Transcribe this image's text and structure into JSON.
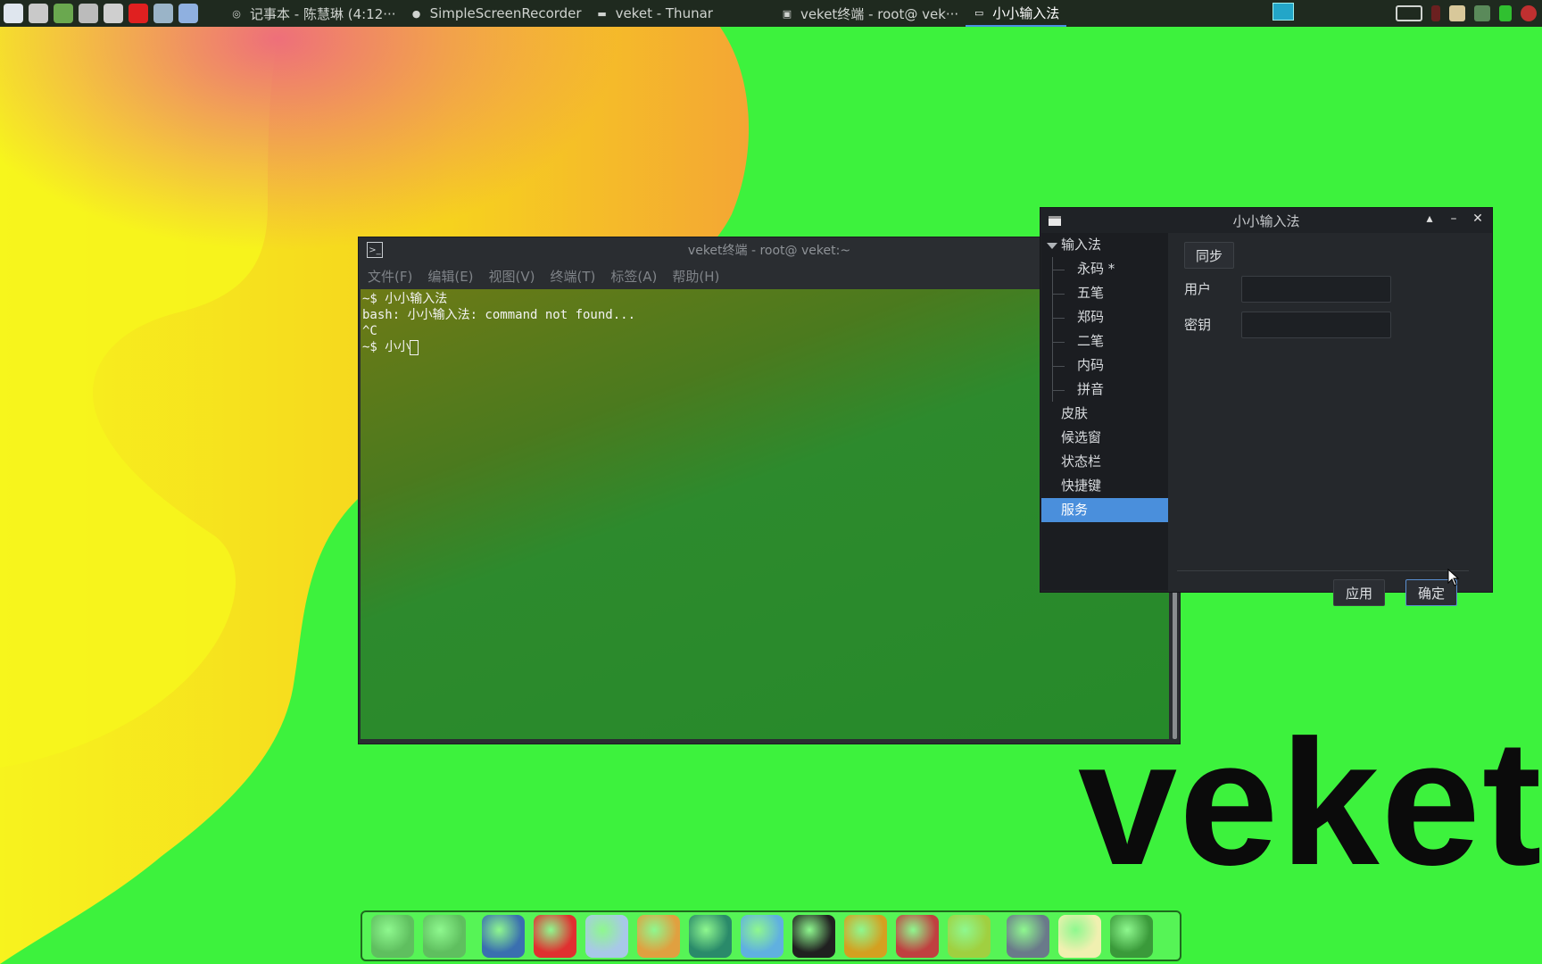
{
  "desktop": {
    "logo_text": "veket"
  },
  "taskbar": {
    "launchers": [
      {
        "icon": "system-monitor-icon",
        "color": "#dfe6ee"
      },
      {
        "icon": "settings-gear-icon",
        "color": "#c9c9c9"
      },
      {
        "icon": "media-play-icon",
        "color": "#6aa84f"
      },
      {
        "icon": "terminal-icon",
        "color": "#bbbbbb"
      },
      {
        "icon": "printer-icon",
        "color": "#cfcfcf"
      },
      {
        "icon": "heart-shield-icon",
        "color": "#e02020"
      },
      {
        "icon": "network-icon",
        "color": "#9ab4c8"
      },
      {
        "icon": "browser-globe-icon",
        "color": "#8fb0e0"
      }
    ],
    "tasks": [
      {
        "label": "记事本 - 陈慧琳 (4:12···",
        "icon": "record-icon",
        "active": false
      },
      {
        "label": "SimpleScreenRecorder",
        "icon": "screen-recorder-icon",
        "active": false
      },
      {
        "label": "veket - Thunar",
        "icon": "folder-icon",
        "active": false
      },
      {
        "label": "veket终端 - root@ vek···",
        "icon": "terminal-icon",
        "active": false
      },
      {
        "label": "小小输入法",
        "icon": "window-icon",
        "active": true
      }
    ]
  },
  "terminal": {
    "title": "veket终端 - root@ veket:~",
    "menu": [
      "文件(F)",
      "编辑(E)",
      "视图(V)",
      "终端(T)",
      "标签(A)",
      "帮助(H)"
    ],
    "lines": [
      "~$ 小小输入法",
      "bash: 小小输入法: command not found...",
      "^C"
    ],
    "prompt": "~$ 小小"
  },
  "ime_window": {
    "title": "小小输入法",
    "tree": {
      "root": "输入法",
      "children": [
        "永码 *",
        "五笔",
        "郑码",
        "二笔",
        "内码",
        "拼音"
      ],
      "items": [
        "皮肤",
        "候选窗",
        "状态栏",
        "快捷键",
        "服务"
      ],
      "selected": "服务"
    },
    "sync_button": "同步",
    "user_label": "用户",
    "user_value": "",
    "key_label": "密钥",
    "key_value": "",
    "apply_button": "应用",
    "ok_button": "确定"
  },
  "dock": {
    "icons": [
      {
        "name": "home-folder-icon",
        "color": "#5fbf5f"
      },
      {
        "name": "files-folder-icon",
        "color": "#5fbf5f"
      },
      {
        "name": "desktop-monitor-icon",
        "color": "#3a6fb0"
      },
      {
        "name": "pet-icon",
        "color": "#e03030"
      },
      {
        "name": "editor-icon",
        "color": "#a8c8e8"
      },
      {
        "name": "paint-palette-icon",
        "color": "#e0a040"
      },
      {
        "name": "network-manager-icon",
        "color": "#2a8a6a"
      },
      {
        "name": "messenger-icon",
        "color": "#60b0e0"
      },
      {
        "name": "qq-penguin-icon",
        "color": "#202020"
      },
      {
        "name": "notebook-icon",
        "color": "#d4a020"
      },
      {
        "name": "presentation-icon",
        "color": "#c04040"
      },
      {
        "name": "help-icon",
        "color": "#a0d040"
      },
      {
        "name": "drive-icon",
        "color": "#6a7a8a"
      },
      {
        "name": "brightness-icon",
        "color": "#f0f0b0"
      },
      {
        "name": "power-globe-icon",
        "color": "#3a9a3a"
      }
    ]
  }
}
